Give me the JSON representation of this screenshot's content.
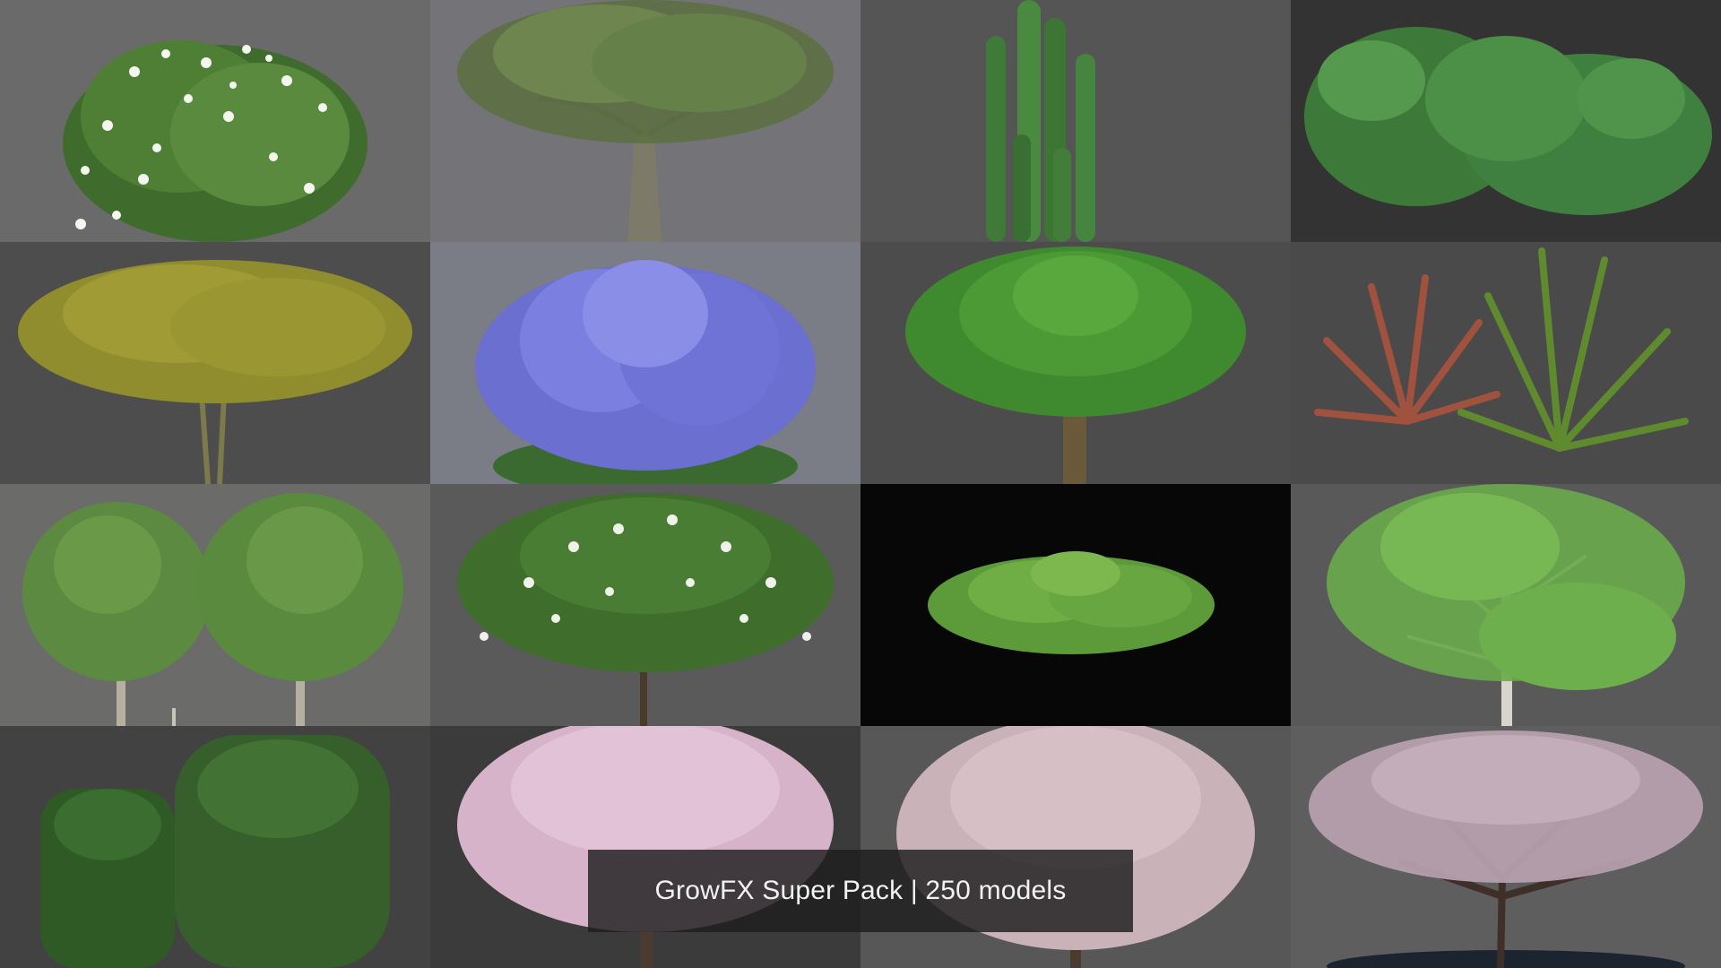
{
  "caption": {
    "text": "GrowFX Super Pack | 250 models"
  },
  "tiles": [
    {
      "name": "flowering-shrub-white",
      "bg": "#6a6a6a"
    },
    {
      "name": "olive-tree",
      "bg": "#737378"
    },
    {
      "name": "columnar-cactus",
      "bg": "#555555"
    },
    {
      "name": "dense-green-shrub",
      "bg": "#333333"
    },
    {
      "name": "yellow-green-tree",
      "bg": "#4d4d4d"
    },
    {
      "name": "lavender-bush",
      "bg": "#7a7c86"
    },
    {
      "name": "palm-tree",
      "bg": "#4c4c4c"
    },
    {
      "name": "cordyline-plants",
      "bg": "#4a4a4a"
    },
    {
      "name": "twin-young-trees",
      "bg": "#6b6b69"
    },
    {
      "name": "flowering-dogwood",
      "bg": "#5a5a5a"
    },
    {
      "name": "ground-cover-plant",
      "bg": "#070707"
    },
    {
      "name": "birch-tree",
      "bg": "#595959"
    },
    {
      "name": "clipped-shrubs",
      "bg": "#424242"
    },
    {
      "name": "weeping-cherry-pink",
      "bg": "#3b3b3b"
    },
    {
      "name": "weeping-cherry-pale",
      "bg": "#575757"
    },
    {
      "name": "weeping-cherry-mauve",
      "bg": "#5e5e5e"
    }
  ]
}
